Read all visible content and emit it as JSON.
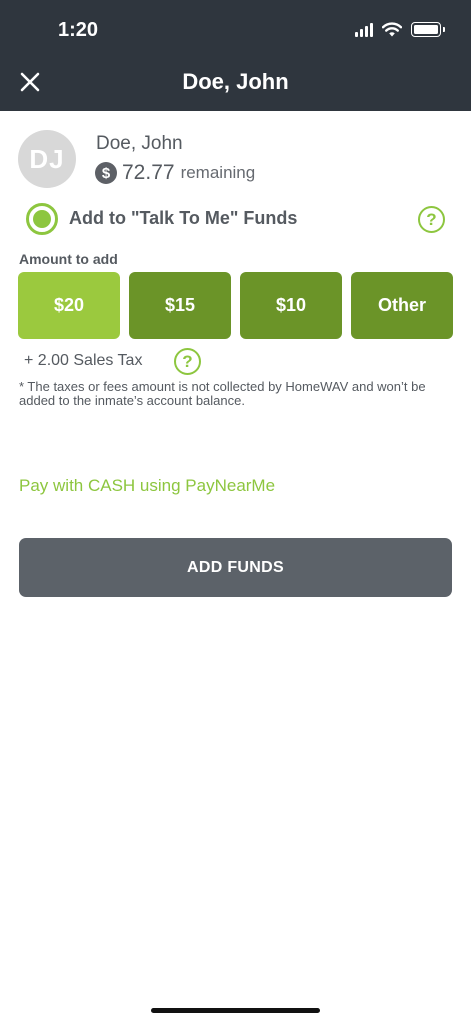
{
  "status_bar": {
    "time": "1:20"
  },
  "header": {
    "title": "Doe, John"
  },
  "profile": {
    "initials": "DJ",
    "name": "Doe, John",
    "balance": "72.77",
    "balance_label": "remaining",
    "currency_symbol": "$"
  },
  "fund_option": {
    "label": "Add to \"Talk To Me\" Funds",
    "selected": true,
    "help_glyph": "?"
  },
  "amount": {
    "heading": "Amount to add",
    "options": [
      {
        "label": "$20",
        "selected": true
      },
      {
        "label": "$15",
        "selected": false
      },
      {
        "label": "$10",
        "selected": false
      },
      {
        "label": "Other",
        "selected": false
      }
    ]
  },
  "tax": {
    "text": "+ 2.00 Sales Tax",
    "help_glyph": "?",
    "disclaimer": "* The taxes or fees amount is not collected by HomeWAV and won’t be added to the inmate’s account balance."
  },
  "cash_link": {
    "label": "Pay with CASH using PayNearMe"
  },
  "submit": {
    "label": "ADD FUNDS"
  },
  "colors": {
    "header_bg": "#2f363e",
    "accent_green": "#8dc63f",
    "selected_amount": "#9bc93e",
    "amount_button": "#6b9428",
    "primary_button": "#5c6269"
  },
  "icons": {
    "close": "close-icon",
    "signal": "cellular-signal-icon",
    "wifi": "wifi-icon",
    "battery": "battery-icon",
    "currency": "dollar-circle-icon",
    "help": "help-circle-icon",
    "radio": "radio-selected-icon"
  }
}
